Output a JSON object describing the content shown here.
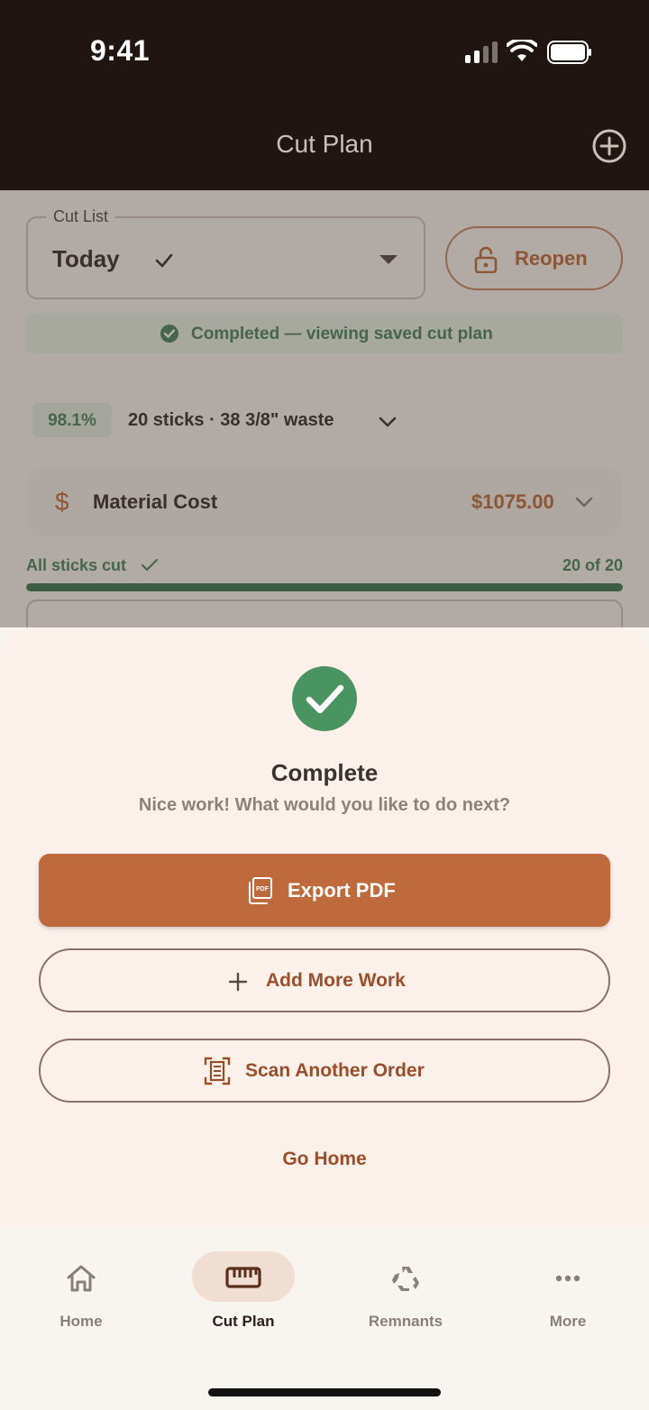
{
  "status_bar": {
    "time": "9:41"
  },
  "nav": {
    "title": "Cut Plan"
  },
  "cut_list": {
    "label": "Cut List",
    "value": "Today"
  },
  "reopen": {
    "label": "Reopen"
  },
  "banner": {
    "text": "Completed — viewing saved cut plan"
  },
  "stats": {
    "yield": "98.1%",
    "summary": "20 sticks · 38 3/8\" waste"
  },
  "cost": {
    "icon": "$",
    "label": "Material Cost",
    "value": "$1075.00"
  },
  "progress": {
    "label": "All sticks cut",
    "count": "20 of 20",
    "fraction": 1.0
  },
  "sheet": {
    "title": "Complete",
    "subtitle": "Nice work! What would you like to do next?",
    "export_label": "Export PDF",
    "add_label": "Add More Work",
    "scan_label": "Scan Another Order",
    "home_label": "Go Home"
  },
  "tabs": [
    {
      "label": "Home",
      "icon": "home-icon"
    },
    {
      "label": "Cut Plan",
      "icon": "ruler-icon",
      "active": true
    },
    {
      "label": "Remnants",
      "icon": "recycle-icon"
    },
    {
      "label": "More",
      "icon": "more-icon"
    }
  ],
  "colors": {
    "header_bg": "#201510",
    "accent": "#BF6A3C",
    "success": "#3F7F55",
    "sheet_bg": "#FCF0EB"
  }
}
